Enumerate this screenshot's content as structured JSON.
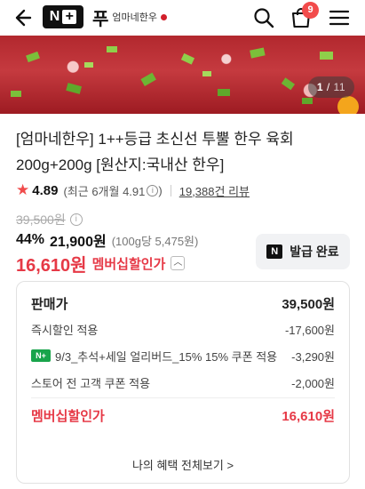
{
  "header": {
    "store_glyph": "푸",
    "store_name": "엄마네한우",
    "cart_count": "9",
    "brand_mark": "N"
  },
  "hero": {
    "page_current": "1",
    "page_separator": "/",
    "page_total": "11"
  },
  "product": {
    "title": "[엄마네한우] 1++등급 초신선 투뿔 한우 육회 200g+200g [원산지:국내산 한우]"
  },
  "rating": {
    "score": "4.89",
    "recent": "(최근 6개월 4.91",
    "recent_close": ")",
    "reviews": "19,388건 리뷰"
  },
  "price": {
    "original": "39,500원",
    "discount_rate": "44%",
    "discount_price": "21,900원",
    "unit_price": "(100g당 5,475원)",
    "member_price": "16,610원",
    "member_label": "멤버십할인가",
    "coupon_button": "발급 완료"
  },
  "breakdown": {
    "rows": [
      {
        "label": "판매가",
        "value": "39,500원"
      },
      {
        "label": "즉시할인 적용",
        "value": "-17,600원"
      },
      {
        "label": "9/3_추석+세일 얼리버드_15% 15% 쿠폰 적용",
        "value": "-3,290원"
      },
      {
        "label": "스토어 전 고객 쿠폰 적용",
        "value": "-2,000원"
      },
      {
        "label": "멤버십할인가",
        "value": "16,610원"
      }
    ],
    "benefit_link": "나의 혜택 전체보기 >"
  },
  "colors": {
    "accent_red": "#e63946",
    "naver_green": "#19a44b",
    "badge_red": "#f24b4b"
  }
}
